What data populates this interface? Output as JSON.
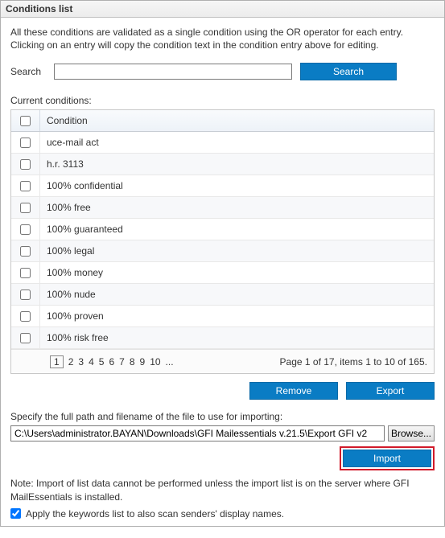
{
  "window": {
    "title": "Conditions list"
  },
  "intro": "All these conditions are validated as a single condition using the OR operator for each entry. Clicking on an entry will copy the condition text in the condition entry above for editing.",
  "search": {
    "label": "Search",
    "value": "",
    "button": "Search"
  },
  "conditions": {
    "label": "Current conditions:",
    "header": "Condition",
    "rows": [
      "uce-mail act",
      "h.r. 3113",
      "100% confidential",
      "100% free",
      "100% guaranteed",
      "100% legal",
      "100% money",
      "100% nude",
      "100% proven",
      "100% risk free"
    ],
    "pager": {
      "pages": [
        "1",
        "2",
        "3",
        "4",
        "5",
        "6",
        "7",
        "8",
        "9",
        "10",
        "..."
      ],
      "info": "Page 1 of 17, items 1 to 10 of 165."
    }
  },
  "actions": {
    "remove": "Remove",
    "export": "Export"
  },
  "import": {
    "label": "Specify the full path and filename of the file to use for importing:",
    "value": "C:\\Users\\administrator.BAYAN\\Downloads\\GFI Mailessentials v.21.5\\Export GFI v2",
    "browse": "Browse...",
    "button": "Import"
  },
  "note": "Note: Import of list data cannot be performed unless the import list is on the server where GFI MailEssentials is installed.",
  "apply": {
    "label": "Apply the keywords list to also scan senders' display names.",
    "checked": true
  }
}
